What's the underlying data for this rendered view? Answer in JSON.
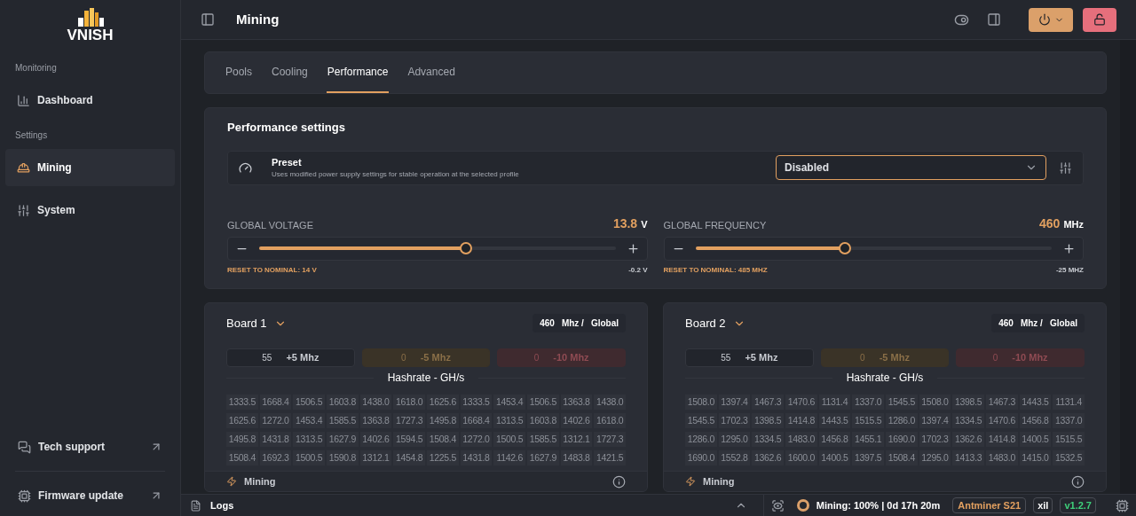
{
  "sidebar": {
    "logo": "VNISH",
    "sections": [
      {
        "title": "Monitoring",
        "items": [
          {
            "label": "Dashboard",
            "selected": false
          }
        ]
      },
      {
        "title": "Settings",
        "items": [
          {
            "label": "Mining",
            "selected": true
          },
          {
            "label": "System",
            "selected": false
          }
        ]
      }
    ],
    "links": [
      {
        "label": "Tech support"
      },
      {
        "label": "Firmware update"
      }
    ]
  },
  "header": {
    "title": "Mining"
  },
  "tabs": [
    {
      "label": "Pools",
      "selected": false
    },
    {
      "label": "Cooling",
      "selected": false
    },
    {
      "label": "Performance",
      "selected": true
    },
    {
      "label": "Advanced",
      "selected": false
    }
  ],
  "performance": {
    "title": "Performance settings",
    "preset": {
      "title": "Preset",
      "description": "Uses modified power supply settings for stable operation at the selected profile",
      "value": "Disabled"
    },
    "sliders": [
      {
        "label": "GLOBAL VOLTAGE",
        "value": "13.8",
        "unit": "V",
        "level": 0.58,
        "reset": "RESET TO NOMINAL: 14 V",
        "delta": "-0.2 V"
      },
      {
        "label": "GLOBAL FREQUENCY",
        "value": "460",
        "unit": "MHz",
        "level": 0.42,
        "reset": "RESET TO NOMINAL: 485 MHZ",
        "delta": "-25 MHZ"
      }
    ]
  },
  "boards": [
    {
      "title": "Board 1",
      "frequency": "460",
      "unit": "Mhz /",
      "mode": "Global",
      "chips": [
        {
          "kind": "normal",
          "count": "55",
          "label": "+5 Mhz"
        },
        {
          "kind": "warning",
          "count": "0",
          "label": "-5 Mhz"
        },
        {
          "kind": "danger",
          "count": "0",
          "label": "-10 Mhz"
        }
      ],
      "hashrate_title": "Hashrate - GH/s",
      "rows": [
        [
          "1333.5",
          "1668.4",
          "1506.5",
          "1603.8",
          "1438.0",
          "1618.0",
          "1625.6",
          "1333.5",
          "1453.4",
          "1506.5",
          "1363.8",
          "1438.0"
        ],
        [
          "1625.6",
          "1272.0",
          "1453.4",
          "1585.5",
          "1363.8",
          "1727.3",
          "1495.8",
          "1668.4",
          "1313.5",
          "1603.8",
          "1402.6",
          "1618.0"
        ],
        [
          "1495.8",
          "1431.8",
          "1313.5",
          "1627.9",
          "1402.6",
          "1594.5",
          "1508.4",
          "1272.0",
          "1500.5",
          "1585.5",
          "1312.1",
          "1727.3"
        ],
        [
          "1508.4",
          "1692.3",
          "1500.5",
          "1590.8",
          "1312.1",
          "1454.8",
          "1225.5",
          "1431.8",
          "1142.6",
          "1627.9",
          "1483.8",
          "1421.5"
        ]
      ],
      "footer": "Mining"
    },
    {
      "title": "Board 2",
      "frequency": "460",
      "unit": "Mhz /",
      "mode": "Global",
      "chips": [
        {
          "kind": "normal",
          "count": "55",
          "label": "+5 Mhz"
        },
        {
          "kind": "warning",
          "count": "0",
          "label": "-5 Mhz"
        },
        {
          "kind": "danger",
          "count": "0",
          "label": "-10 Mhz"
        }
      ],
      "hashrate_title": "Hashrate - GH/s",
      "rows": [
        [
          "1508.0",
          "1397.4",
          "1467.3",
          "1470.6",
          "1131.4",
          "1337.0",
          "1545.5",
          "1508.0",
          "1398.5",
          "1467.3",
          "1443.5",
          "1131.4"
        ],
        [
          "1545.5",
          "1702.3",
          "1398.5",
          "1414.8",
          "1443.5",
          "1515.5",
          "1286.0",
          "1397.4",
          "1334.5",
          "1470.6",
          "1456.8",
          "1337.0"
        ],
        [
          "1286.0",
          "1295.0",
          "1334.5",
          "1483.0",
          "1456.8",
          "1455.1",
          "1690.0",
          "1702.3",
          "1362.6",
          "1414.8",
          "1400.5",
          "1515.5"
        ],
        [
          "1690.0",
          "1552.8",
          "1362.6",
          "1600.0",
          "1400.5",
          "1397.5",
          "1508.4",
          "1295.0",
          "1413.3",
          "1483.0",
          "1415.0",
          "1532.5"
        ]
      ],
      "footer": "Mining"
    }
  ],
  "status_bar": {
    "logs": "Logs",
    "status": "Mining: 100% | 0d 17h 20m",
    "model": "Antminer S21",
    "user": "xil",
    "version": "v1.2.7"
  }
}
